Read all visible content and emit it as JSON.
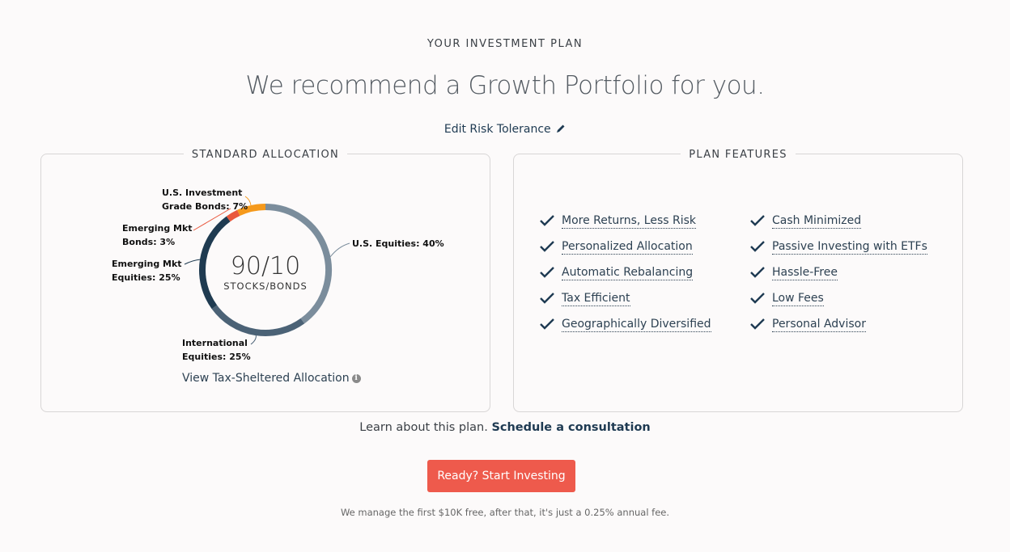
{
  "header": {
    "eyebrow": "YOUR INVESTMENT PLAN",
    "headline": "We recommend a Growth Portfolio for you.",
    "edit_risk_label": "Edit Risk Tolerance",
    "edit_icon": "pencil-icon"
  },
  "allocation": {
    "title": "STANDARD ALLOCATION",
    "center_ratio": "90/10",
    "center_label": "STOCKS/BONDS",
    "tax_link": "View Tax-Sheltered Allocation",
    "info_icon": "info-icon"
  },
  "chart_data": {
    "type": "pie",
    "variant": "donut",
    "start": "top",
    "direction": "clockwise",
    "slices": [
      {
        "name": "U.S. Equities",
        "value": 40,
        "label_line1": "U.S. Equities: 40%",
        "label_line2": "",
        "color": "#7b8d9c"
      },
      {
        "name": "International Equities",
        "value": 25,
        "label_line1": "International",
        "label_line2": "Equities: 25%",
        "color": "#4b6276"
      },
      {
        "name": "Emerging Mkt Equities",
        "value": 25,
        "label_line1": "Emerging Mkt",
        "label_line2": "Equities: 25%",
        "color": "#1f3b51"
      },
      {
        "name": "Emerging Mkt Bonds",
        "value": 3,
        "label_line1": "Emerging Mkt",
        "label_line2": "Bonds: 3%",
        "color": "#e9583d"
      },
      {
        "name": "U.S. Investment Grade Bonds",
        "value": 7,
        "label_line1": "U.S. Investment",
        "label_line2": "Grade Bonds: 7%",
        "color": "#f5991b"
      }
    ]
  },
  "features": {
    "title": "PLAN FEATURES",
    "check_icon": "checkmark-icon",
    "col1": [
      "More Returns, Less Risk",
      "Personalized Allocation",
      "Automatic Rebalancing",
      "Tax Efficient",
      "Geographically Diversified"
    ],
    "col2": [
      "Cash Minimized",
      "Passive Investing with ETFs",
      "Hassle-Free",
      "Low Fees",
      "Personal Advisor"
    ]
  },
  "footer": {
    "learn_text": "Learn about this plan. ",
    "schedule_link": "Schedule a consultation",
    "cta_label": "Ready? Start Investing",
    "fee_note": "We manage the first $10K free, after that, it's just a 0.25% annual fee.",
    "cta_color": "#ee5a4c"
  }
}
